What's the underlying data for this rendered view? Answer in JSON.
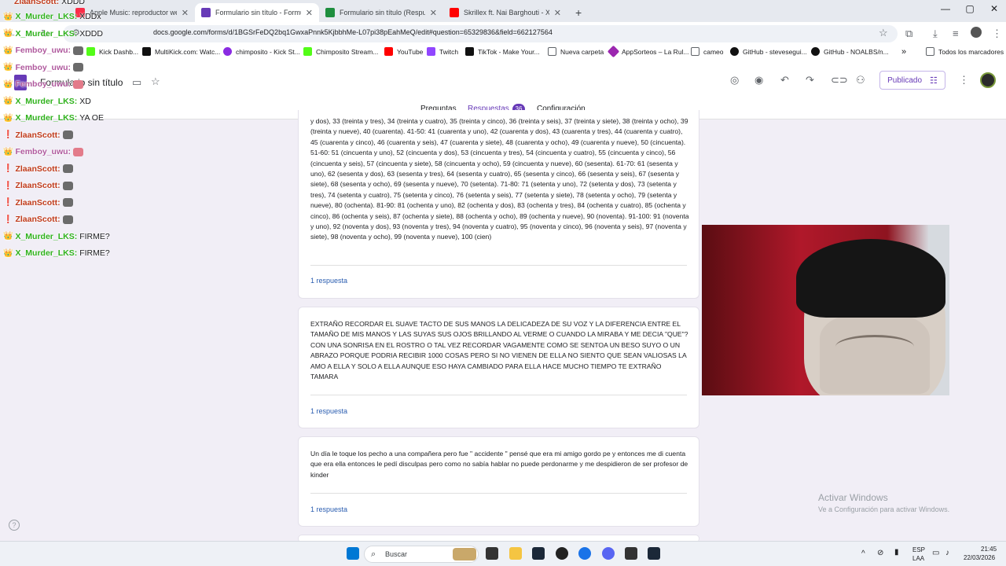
{
  "browser": {
    "tabs": [
      {
        "label": "Apple Music: reproductor web",
        "color": "#fa2d48",
        "active": false
      },
      {
        "label": "Formulario sin título - Formula",
        "color": "#673ab7",
        "active": true
      },
      {
        "label": "Formulario sin título (Respuestas",
        "color": "#1e8e3e",
        "active": false
      },
      {
        "label": "Skrillex ft. Nai Barghouti - XEN",
        "color": "#ff0000",
        "active": false
      }
    ],
    "new_tab": "+",
    "window_controls": [
      "—",
      "▢",
      "✕"
    ],
    "url": "docs.google.com/forms/d/1BGSrFeDQ2bq1GwxaPnnk5KjbbhMe-L07pi38pEahMeQ/edit#question=65329836&field=662127564",
    "bookmarks": [
      {
        "label": "Kick Dashb...",
        "color": "#53fc18"
      },
      {
        "label": "MultiKick.com: Watc...",
        "color": "#111111"
      },
      {
        "label": "chimposito - Kick St...",
        "color": "#8a2be2"
      },
      {
        "label": "Chimposito Stream...",
        "color": "#53fc18"
      },
      {
        "label": "YouTube",
        "color": "#ff0000"
      },
      {
        "label": "Twitch",
        "color": "#9146ff"
      },
      {
        "label": "TikTok - Make Your...",
        "color": "#111111"
      },
      {
        "label": "Nueva carpeta",
        "color": "#5f6368"
      },
      {
        "label": "AppSorteos – La Rul...",
        "color": "#9c27b0"
      },
      {
        "label": "cameo",
        "color": "#5f6368"
      },
      {
        "label": "GitHub - stevesegui...",
        "color": "#111111"
      },
      {
        "label": "GitHub - NOALBS/n...",
        "color": "#111111"
      }
    ],
    "bookmarks_more": "»",
    "all_bookmarks": "Todos los marcadores"
  },
  "forms": {
    "title": "Formulario sin título",
    "publish_label": "Publicado",
    "tabs": [
      {
        "label": "Preguntas"
      },
      {
        "label": "Respuestas",
        "count": "36"
      },
      {
        "label": "Configuración"
      }
    ],
    "accent": "#673ab7"
  },
  "responses": [
    {
      "text": "y dos), 33 (treinta y tres), 34 (treinta y cuatro), 35 (treinta y cinco), 36 (treinta y seis), 37 (treinta y siete), 38 (treinta y ocho), 39 (treinta y nueve), 40 (cuarenta). 41-50: 41 (cuarenta y uno), 42 (cuarenta y dos), 43 (cuarenta y tres), 44 (cuarenta y cuatro), 45 (cuarenta y cinco), 46 (cuarenta y seis), 47 (cuarenta y siete), 48 (cuarenta y ocho), 49 (cuarenta y nueve), 50 (cincuenta). 51-60: 51 (cincuenta y uno), 52 (cincuenta y dos), 53 (cincuenta y tres), 54 (cincuenta y cuatro), 55 (cincuenta y cinco), 56 (cincuenta y seis), 57 (cincuenta y siete), 58 (cincuenta y ocho), 59 (cincuenta y nueve), 60 (sesenta). 61-70: 61 (sesenta y uno), 62 (sesenta y dos), 63 (sesenta y tres), 64 (sesenta y cuatro), 65 (sesenta y cinco), 66 (sesenta y seis), 67 (sesenta y siete), 68 (sesenta y ocho), 69 (sesenta y nueve), 70 (setenta). 71-80: 71 (setenta y uno), 72 (setenta y dos), 73 (setenta y tres), 74 (setenta y cuatro), 75 (setenta y cinco), 76 (setenta y seis), 77 (setenta y siete), 78 (setenta y ocho), 79 (setenta y nueve), 80 (ochenta). 81-90: 81 (ochenta y uno), 82 (ochenta y dos), 83 (ochenta y tres), 84 (ochenta y cuatro), 85 (ochenta y cinco), 86 (ochenta y seis), 87 (ochenta y siete), 88 (ochenta y ocho), 89 (ochenta y nueve), 90 (noventa). 91-100: 91 (noventa y uno), 92 (noventa y dos), 93 (noventa y tres), 94 (noventa y cuatro), 95 (noventa y cinco), 96 (noventa y seis), 97 (noventa y siete), 98 (noventa y ocho), 99 (noventa y nueve), 100 (cien)",
      "count": "1 respuesta"
    },
    {
      "text": "EXTRAÑO RECORDAR EL SUAVE TACTO DE SUS MANOS LA DELICADEZA DE SU VOZ Y LA DIFERENCIA ENTRE EL TAMAÑO DE MIS MANOS Y LAS SUYAS SUS OJOS BRILLANDO AL VERME O CUANDO LA MIRABA Y ME DECIA \"QUE\"? CON UNA SONRISA EN EL ROSTRO O TAL VEZ RECORDAR VAGAMENTE COMO SE SENTOA UN BESO SUYO O UN ABRAZO PORQUE PODRIA RECIBIR 1000 COSAS PERO SI NO VIENEN DE ELLA NO SIENTO QUE SEAN VALIOSAS LA AMO A ELLA Y SOLO A ELLA AUNQUE ESO HAYA CAMBIADO PARA ELLA HACE MUCHO TIEMPO TE EXTRAÑO TAMARA",
      "count": "1 respuesta"
    },
    {
      "text": "Un día le toque los pecho a una compañera pero fue \" accidente \" pensé que era mi amigo gordo pe y entonces me di cuenta que era ella entonces le pedí disculpas pero como no sabía hablar no puede perdonarme y me despidieron de ser profesor de kinder",
      "count": "1 respuesta"
    }
  ],
  "chat": [
    {
      "badge": "👑",
      "user": "X_Murder_LKS:",
      "msg": "XDDx",
      "kind": "x"
    },
    {
      "badge": "👑",
      "user": "X_Murder_LKS:",
      "msg": "XDDD",
      "kind": "x"
    },
    {
      "badge": "👑",
      "user": "Femboy_uwu:",
      "msg": "",
      "kind": "p",
      "emote": "gray"
    },
    {
      "badge": "👑",
      "user": "Femboy_uwu:",
      "msg": "",
      "kind": "p",
      "emote": "gray"
    },
    {
      "badge": "👑",
      "user": "Femboy_uwu:",
      "msg": "",
      "kind": "p",
      "emote": "pig"
    },
    {
      "badge": "👑",
      "user": "X_Murder_LKS:",
      "msg": "XD",
      "kind": "x"
    },
    {
      "badge": "👑",
      "user": "X_Murder_LKS:",
      "msg": "YA OE",
      "kind": "x"
    },
    {
      "badge": "❗",
      "user": "ZlaanScott:",
      "msg": "",
      "kind": "z",
      "emote": "gray"
    },
    {
      "badge": "👑",
      "user": "Femboy_uwu:",
      "msg": "",
      "kind": "p",
      "emote": "pig"
    },
    {
      "badge": "❗",
      "user": "ZlaanScott:",
      "msg": "",
      "kind": "z",
      "emote": "gray"
    },
    {
      "badge": "❗",
      "user": "ZlaanScott:",
      "msg": "",
      "kind": "z",
      "emote": "gray"
    },
    {
      "badge": "❗",
      "user": "ZlaanScott:",
      "msg": "",
      "kind": "z",
      "emote": "gray"
    },
    {
      "badge": "❗",
      "user": "ZlaanScott:",
      "msg": "",
      "kind": "z",
      "emote": "gray"
    },
    {
      "badge": "👑",
      "user": "X_Murder_LKS:",
      "msg": "FIRME?",
      "kind": "x"
    },
    {
      "badge": "👑",
      "user": "X_Murder_LKS:",
      "msg": "FIRME?",
      "kind": "x"
    }
  ],
  "chat_top": {
    "user": "ZlaanScott:",
    "msg": "XDDD"
  },
  "watermark": {
    "title": "Activar Windows",
    "subtitle": "Ve a Configuración para activar Windows."
  },
  "taskbar": {
    "search_placeholder": "Buscar",
    "lang_line1": "ESP",
    "lang_line2": "LAA",
    "time": "21:45",
    "date": "22/03/2026"
  },
  "help_icon": "?"
}
